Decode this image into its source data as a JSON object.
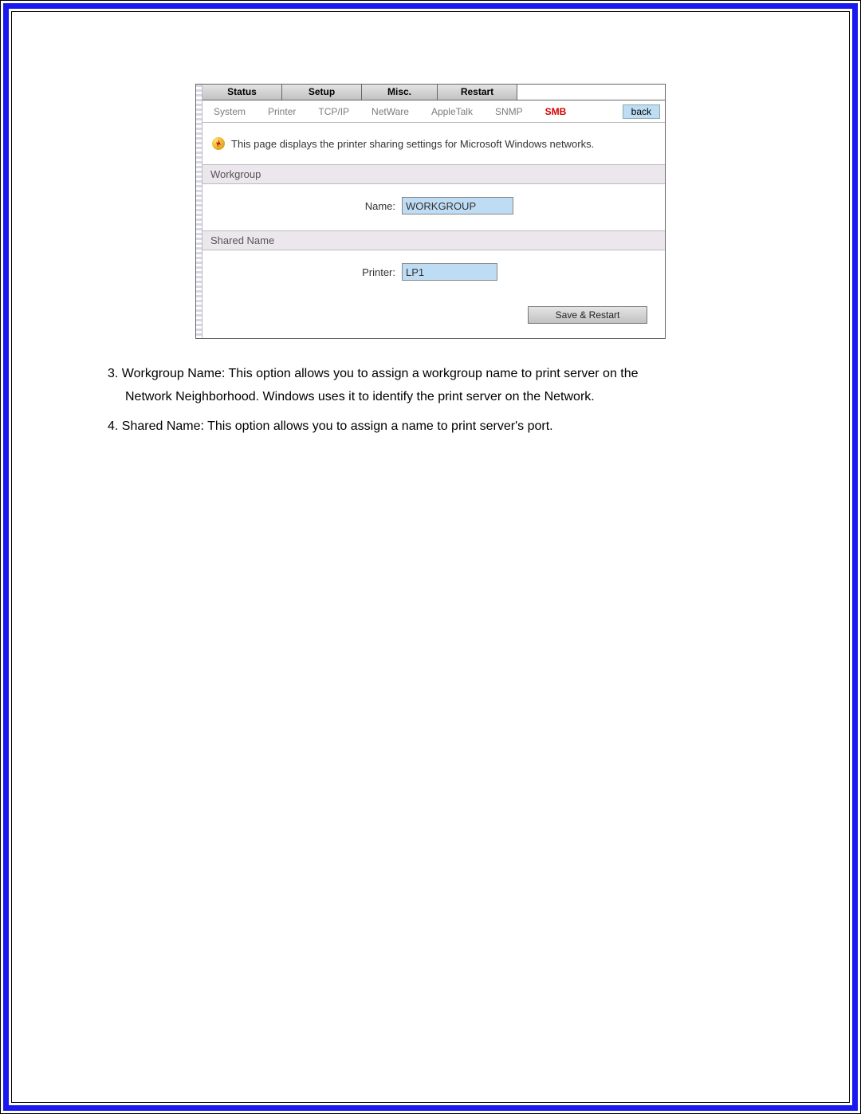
{
  "tabs": {
    "status": "Status",
    "setup": "Setup",
    "misc": "Misc.",
    "restart": "Restart"
  },
  "subnav": {
    "system": "System",
    "printer": "Printer",
    "tcpip": "TCP/IP",
    "netware": "NetWare",
    "appletalk": "AppleTalk",
    "snmp": "SNMP",
    "smb": "SMB",
    "back": "back"
  },
  "info_text": "This page displays the printer sharing settings for Microsoft Windows networks.",
  "sections": {
    "workgroup": {
      "title": "Workgroup",
      "label": "Name:",
      "value": "WORKGROUP"
    },
    "shared": {
      "title": "Shared Name",
      "label": "Printer:",
      "value": "LP1"
    }
  },
  "save_button": "Save & Restart",
  "doc": {
    "item3_lead": "3. Workgroup Name: This option allows you to assign a workgroup name to print server on the",
    "item3_rest": "Network Neighborhood. Windows uses it to identify the print server on the Network.",
    "item4": "4. Shared Name: This option allows you to assign a name to print server's port."
  }
}
